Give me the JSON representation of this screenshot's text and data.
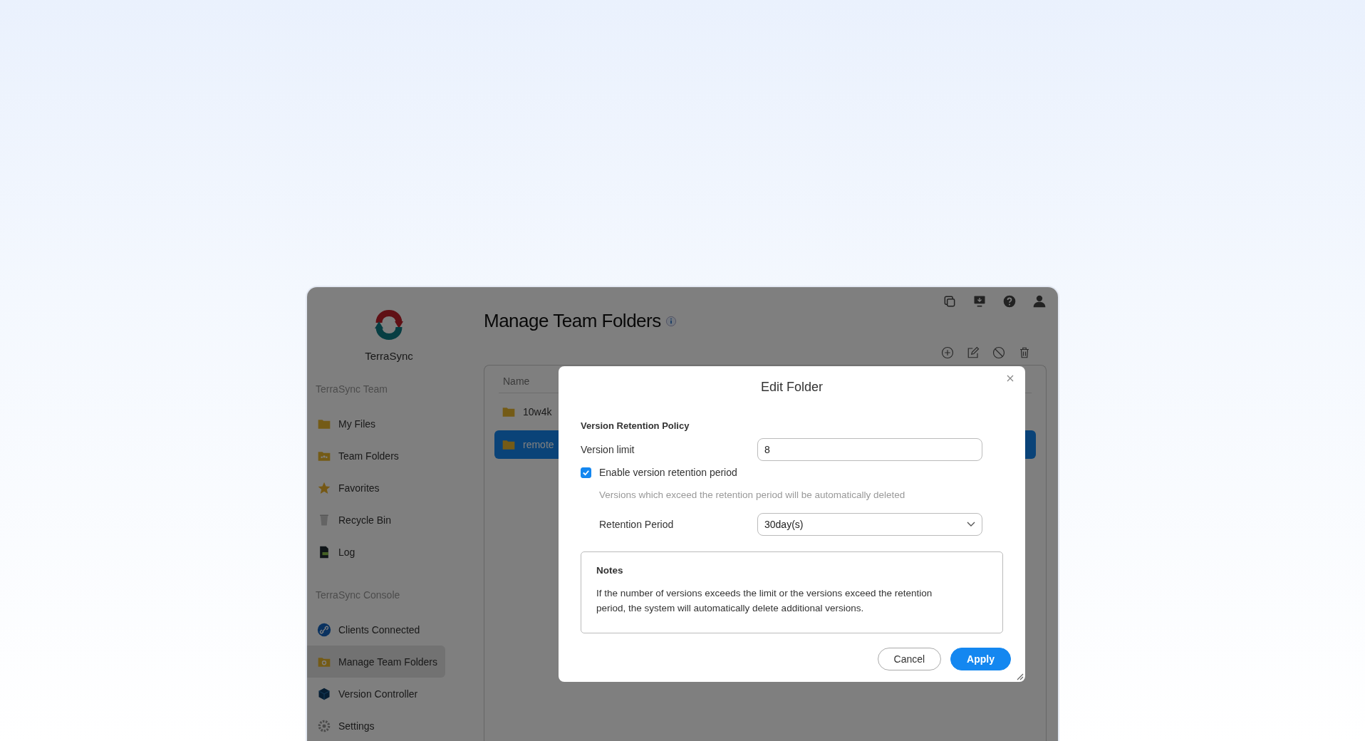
{
  "top_icons": [
    {
      "kind": "windows"
    },
    {
      "kind": "monitor"
    },
    {
      "kind": "help"
    },
    {
      "kind": "user"
    }
  ],
  "sidebar": {
    "app_name": "TerraSync",
    "sections": [
      {
        "title": "TerraSync Team",
        "items": [
          {
            "kind": "folder",
            "label": "My Files",
            "selected": false
          },
          {
            "kind": "team-folder",
            "label": "Team Folders",
            "selected": false
          },
          {
            "kind": "star",
            "label": "Favorites",
            "selected": false
          },
          {
            "kind": "bin",
            "label": "Recycle Bin",
            "selected": false
          },
          {
            "kind": "log",
            "label": "Log",
            "selected": false
          }
        ]
      },
      {
        "title": "TerraSync Console",
        "items": [
          {
            "kind": "link",
            "label": "Clients Connected",
            "selected": false
          },
          {
            "kind": "gear-folder",
            "label": "Manage Team Folders",
            "selected": true
          },
          {
            "kind": "cube",
            "label": "Version Controller",
            "selected": false
          },
          {
            "kind": "gear",
            "label": "Settings",
            "selected": false
          }
        ]
      }
    ]
  },
  "page": {
    "title": "Manage Team Folders",
    "toolbar": [
      {
        "kind": "add"
      },
      {
        "kind": "edit"
      },
      {
        "kind": "disable"
      },
      {
        "kind": "delete"
      }
    ],
    "table": {
      "columns": [
        "Name"
      ],
      "rows": [
        {
          "name": "10w4k",
          "selected": false
        },
        {
          "name": "remote",
          "selected": true
        }
      ]
    }
  },
  "dialog": {
    "title": "Edit Folder",
    "section": "Version Retention Policy",
    "version_limit": {
      "label": "Version limit",
      "value": "8"
    },
    "retention": {
      "label": "Enable version retention period",
      "checked": true,
      "hint": "Versions which exceed the retention period will be automatically deleted"
    },
    "period": {
      "label": "Retention Period",
      "value": "30day(s)"
    },
    "notes": {
      "title": "Notes",
      "text": "If the number of versions exceeds the limit or the versions exceed the retention period, the system will automatically delete additional versions."
    },
    "buttons": [
      {
        "kind": "secondary",
        "label": "Cancel"
      },
      {
        "kind": "primary",
        "label": "Apply"
      }
    ]
  }
}
